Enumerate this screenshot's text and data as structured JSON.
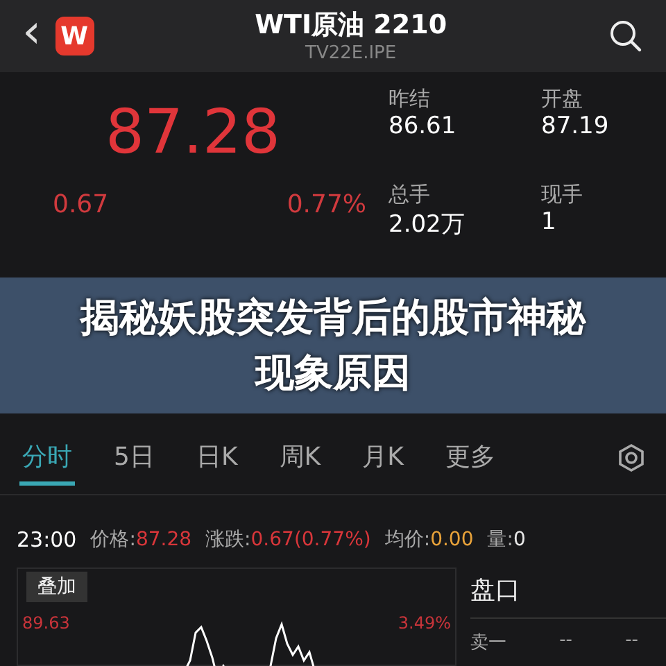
{
  "header": {
    "back": "‹",
    "logo": "W",
    "title": "WTI原油 2210",
    "code": "TV22E.IPE"
  },
  "quote": {
    "price": "87.28",
    "change": "0.67",
    "percent": "0.77%",
    "stats": [
      {
        "label": "昨结",
        "value": "86.61"
      },
      {
        "label": "开盘",
        "value": "87.19"
      },
      {
        "label": "总手",
        "value": "2.02万"
      },
      {
        "label": "现手",
        "value": "1"
      }
    ]
  },
  "banner": {
    "title": "揭秘妖股突发背后的股市神秘现象原因"
  },
  "tabs": [
    {
      "label": "分时",
      "selected": true
    },
    {
      "label": "5日",
      "selected": false
    },
    {
      "label": "日K",
      "selected": false
    },
    {
      "label": "周K",
      "selected": false
    },
    {
      "label": "月K",
      "selected": false
    },
    {
      "label": "更多",
      "selected": false
    }
  ],
  "info": {
    "time": "23:00",
    "items": [
      {
        "label": "价格:",
        "value": "87.28",
        "color": "#d8363a"
      },
      {
        "label": "涨跌:",
        "value": "0.67(0.77%)",
        "color": "#d8363a"
      },
      {
        "label": "均价:",
        "value": "0.00",
        "color": "#e8a23a"
      },
      {
        "label": "量:",
        "value": "0",
        "color": "#e8e8e8"
      }
    ]
  },
  "chart": {
    "overlay": "叠加",
    "high": "89.63",
    "high_pct": "3.49%"
  },
  "book": {
    "title": "盘口",
    "rows": [
      {
        "label": "卖一",
        "price": "--",
        "volume": "--"
      }
    ]
  }
}
